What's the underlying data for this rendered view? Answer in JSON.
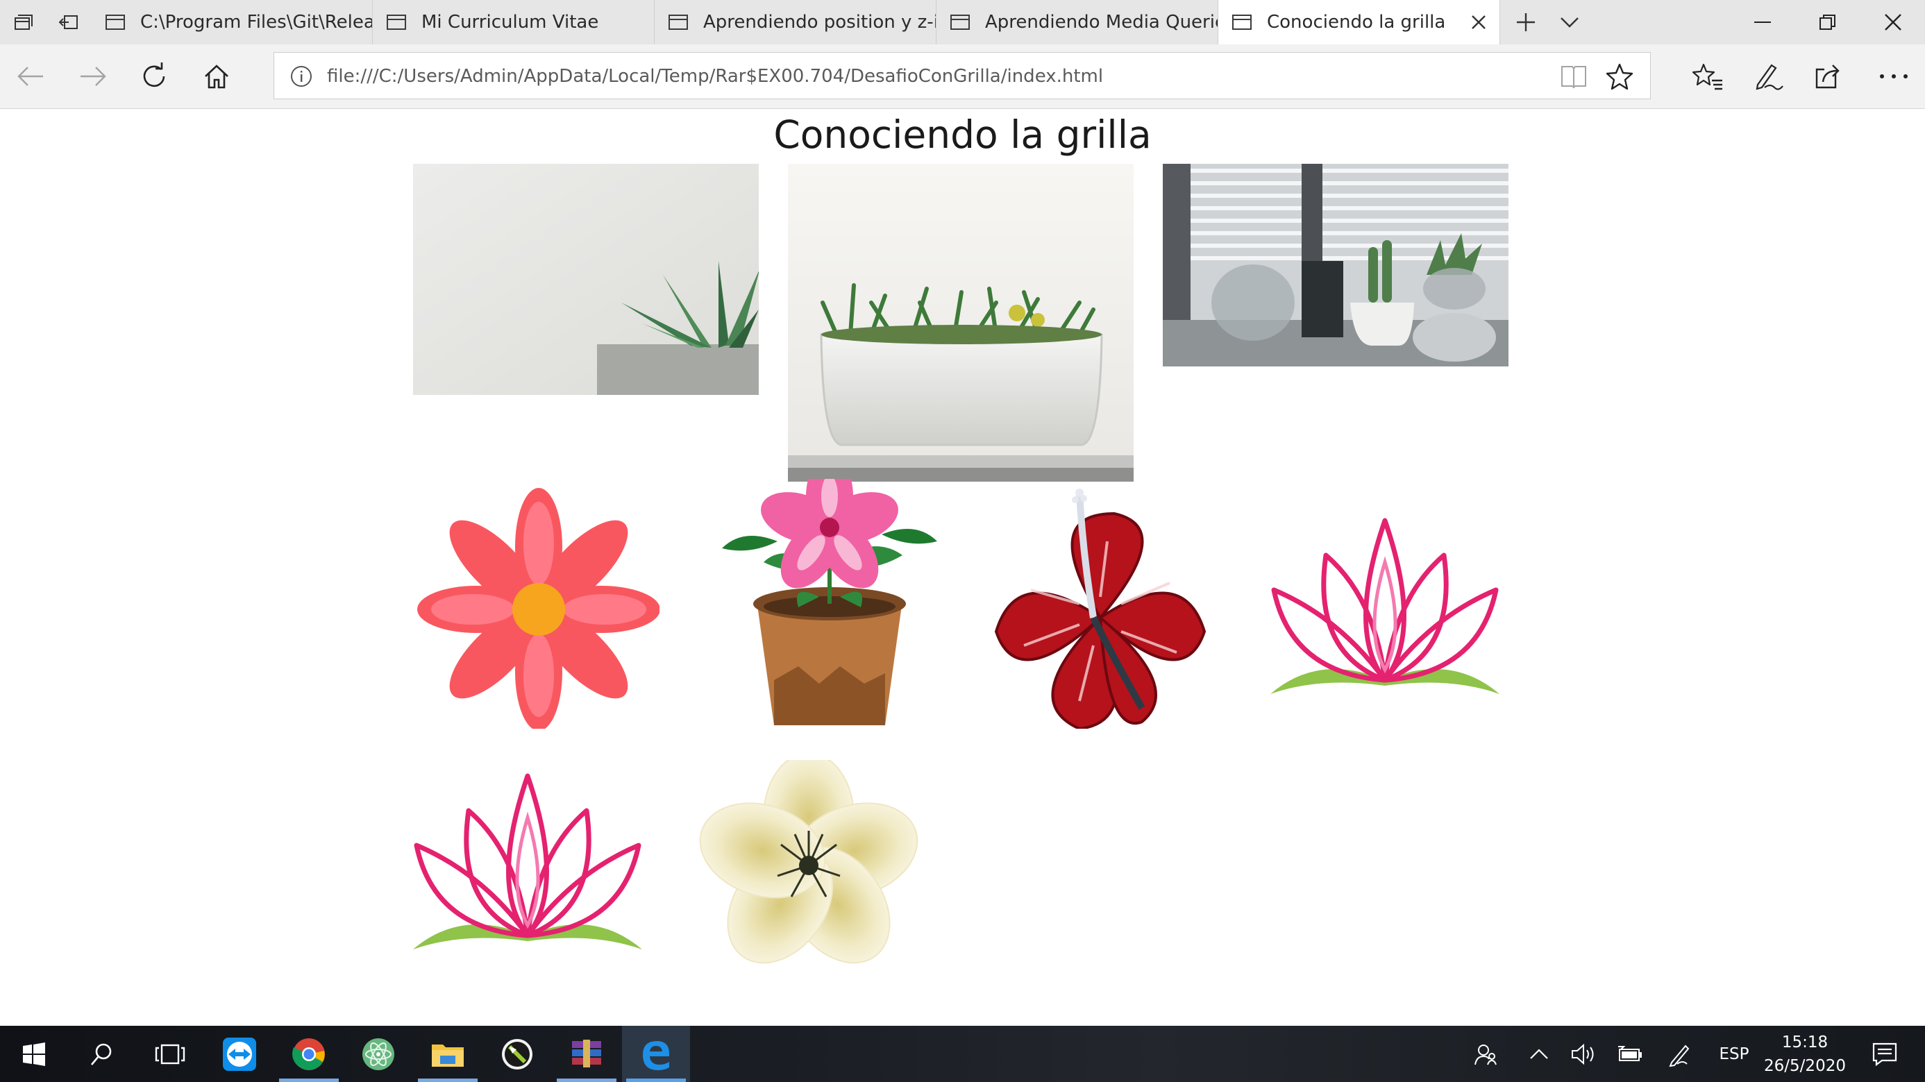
{
  "browser": {
    "tabs": [
      {
        "label": "C:\\Program Files\\Git\\Releas"
      },
      {
        "label": "Mi Curriculum Vitae"
      },
      {
        "label": "Aprendiendo position y z-ir"
      },
      {
        "label": "Aprendiendo Media Querie"
      },
      {
        "label": "Conociendo la grilla",
        "active": true
      }
    ],
    "address": "file:///C:/Users/Admin/AppData/Local/Temp/Rar$EX00.704/DesafioConGrilla/index.html"
  },
  "page": {
    "title": "Conociendo la grilla"
  },
  "taskbar": {
    "language": "ESP",
    "time": "15:18",
    "date": "26/5/2020"
  },
  "colors": {
    "accent": "#0078d7",
    "tab_strip": "#e6e6e6",
    "nav_bar": "#f2f2f2",
    "taskbar": "#181b20"
  },
  "icons": [
    "tab-list-icon",
    "set-aside-tabs-icon",
    "new-tab-icon",
    "tab-preview-chevron-icon",
    "minimize-icon",
    "restore-icon",
    "close-icon",
    "back-icon",
    "forward-icon",
    "refresh-icon",
    "home-icon",
    "info-icon",
    "reading-view-icon",
    "favorite-star-icon",
    "favorites-hub-icon",
    "pen-notes-icon",
    "share-icon",
    "more-icon",
    "windows-start-icon",
    "search-icon",
    "task-view-icon",
    "teamviewer-icon",
    "chrome-icon",
    "atom-icon",
    "file-explorer-icon",
    "inkscape-icon",
    "winrar-icon",
    "edge-icon",
    "people-icon",
    "show-hidden-icon",
    "volume-icon",
    "battery-icon",
    "pen-workspace-icon",
    "action-center-icon"
  ]
}
